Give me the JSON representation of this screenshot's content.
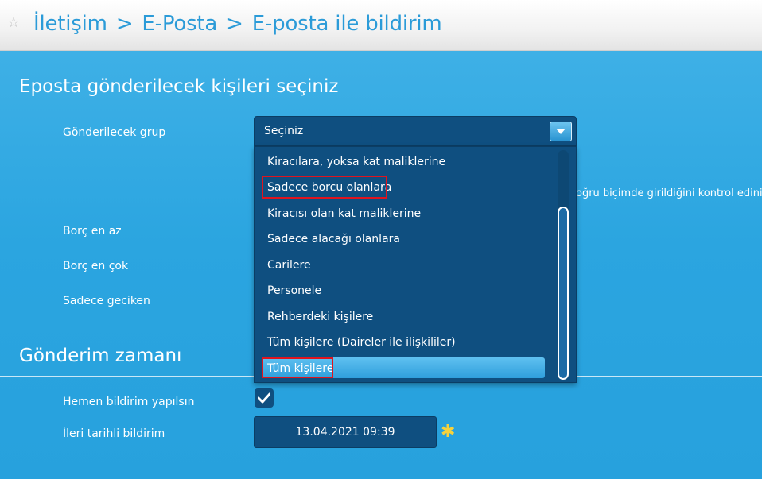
{
  "breadcrumb": {
    "items": [
      "İletişim",
      "E-Posta",
      "E-posta ile bildirim"
    ],
    "separator": ">"
  },
  "section1": {
    "title": "Eposta gönderilecek kişileri seçiniz",
    "fields": {
      "group_label": "Gönderilecek grup",
      "min_debt_label": "Borç en az",
      "max_debt_label": "Borç en çok",
      "late_only_label": "Sadece geciken"
    },
    "hint": "oğru biçimde girildiğini kontrol ediniz."
  },
  "group_select": {
    "value": "Seçiniz",
    "options": [
      "Kiracılara, yoksa kat maliklerine",
      "Sadece borcu olanlara",
      "Kiracısı olan kat maliklerine",
      "Sadece alacağı olanlara",
      "Carilere",
      "Personele",
      "Rehberdeki kişilere",
      "Tüm kişilere (Daireler ile ilişkililer)",
      "Tüm kişilere"
    ],
    "highlighted_option": "Tüm kişilere",
    "annotated_options": [
      "Sadece borcu olanlara",
      "Tüm kişilere"
    ]
  },
  "section2": {
    "title": "Gönderim zamanı",
    "immediate_label": "Hemen bildirim yapılsın",
    "immediate_checked": true,
    "scheduled_label": "İleri tarihli bildirim",
    "scheduled_value": "13.04.2021 09:39"
  },
  "colors": {
    "background": "#29a3df",
    "control": "#0f4f80",
    "annotation": "#e0141e",
    "breadcrumb_text": "#2b9bd8"
  },
  "icons": [
    "star-icon",
    "chevron-down-icon",
    "checkmark-icon",
    "asterisk-icon"
  ]
}
